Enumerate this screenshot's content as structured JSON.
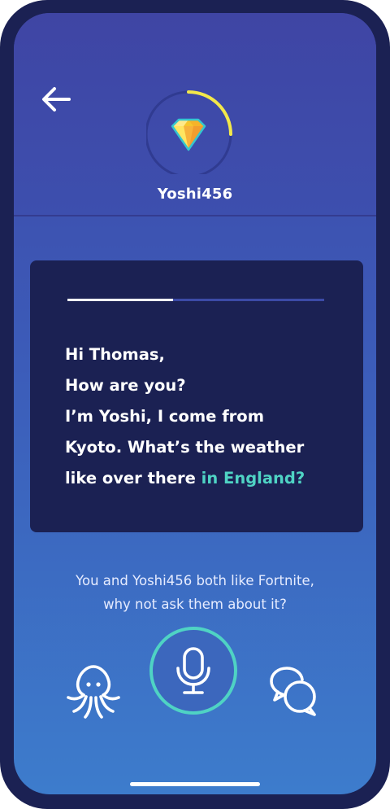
{
  "header": {
    "username": "Yoshi456",
    "avatar_icon": "diamond-icon",
    "back_icon": "back-arrow-icon",
    "level_progress": 0.25
  },
  "message": {
    "progress": 0.41,
    "lines": [
      "Hi Thomas,",
      "How are you?",
      "I’m Yoshi, I come from",
      "Kyoto. What’s the weather"
    ],
    "last_line_plain": "like over there",
    "last_line_highlight": "in England?"
  },
  "suggestion": {
    "lines": [
      "You and Yoshi456 both like Fortnite,",
      "why not ask them about it?"
    ]
  },
  "controls": {
    "left_icon": "octopus-icon",
    "center_icon": "microphone-icon",
    "right_icon": "chat-bubbles-icon"
  },
  "colors": {
    "background_top": "#3f46a6",
    "background_bottom": "#3d7ccc",
    "card": "#1b2153",
    "accent_teal": "#4fd3c4",
    "accent_yellow": "#f3e84a"
  }
}
